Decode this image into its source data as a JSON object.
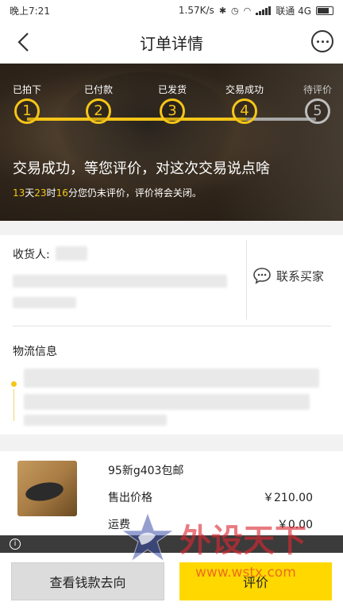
{
  "status_bar": {
    "time": "晚上7:21",
    "network_speed": "1.57K/s",
    "carrier": "联通 4G"
  },
  "header": {
    "title": "订单详情"
  },
  "steps": [
    {
      "label": "已拍下",
      "number": "1",
      "state": "done"
    },
    {
      "label": "已付款",
      "number": "2",
      "state": "done"
    },
    {
      "label": "已发货",
      "number": "3",
      "state": "done"
    },
    {
      "label": "交易成功",
      "number": "4",
      "state": "done"
    },
    {
      "label": "待评价",
      "number": "5",
      "state": "pending"
    }
  ],
  "order_status": {
    "headline": "交易成功，等您评价，对这次交易说点啥",
    "days": "13",
    "days_unit": "天",
    "hours": "23",
    "hours_unit": "时",
    "minutes": "16",
    "notice": "分您仍未评价，评价将会关闭。"
  },
  "receiver": {
    "label": "收货人:",
    "contact_label": "联系买家"
  },
  "logistics": {
    "label": "物流信息"
  },
  "product": {
    "name": "95新g403包邮",
    "price_label": "售出价格",
    "price_value": "￥210.00",
    "shipping_label": "运费",
    "shipping_value": "￥0.00"
  },
  "actions": {
    "view_money": "查看钱款去向",
    "review": "评价"
  },
  "watermark": {
    "text": "外设天下",
    "url": "www.wstx.com"
  },
  "colors": {
    "accent": "#ffd800",
    "step_active": "#f5c518",
    "step_pending": "#bdbdbd"
  }
}
